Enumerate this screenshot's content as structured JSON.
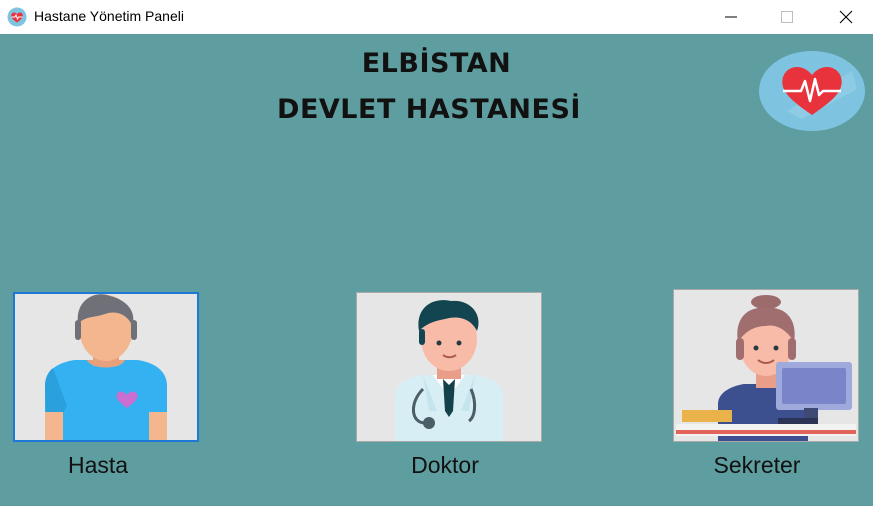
{
  "window": {
    "title": "Hastane Yönetim Paneli"
  },
  "hospital": {
    "title_line1": "ELBİSTAN",
    "title_line2": "DEVLET HASTANESİ"
  },
  "roles": [
    {
      "label": "Hasta",
      "icon": "patient-icon"
    },
    {
      "label": "Doktor",
      "icon": "doctor-icon"
    },
    {
      "label": "Sekreter",
      "icon": "secretary-icon"
    }
  ],
  "colors": {
    "background": "#5f9ea0",
    "selected_border": "#1e78d6",
    "heart": "#e8323c"
  }
}
